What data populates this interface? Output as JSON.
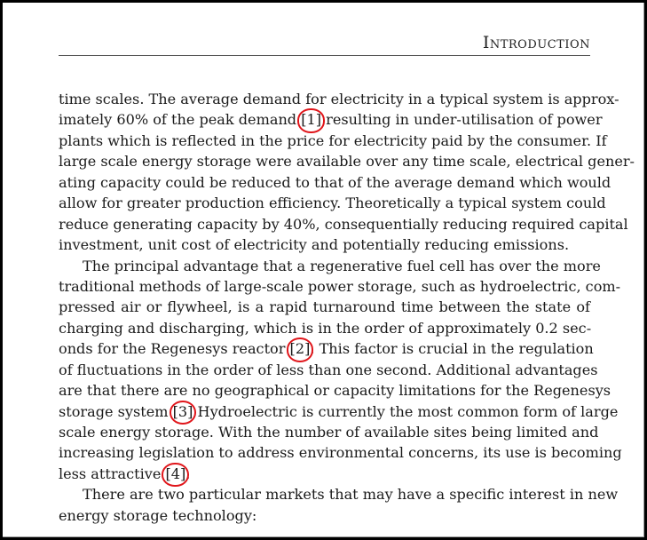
{
  "header": {
    "running_title": "Introduction"
  },
  "annotation_color": "#e0161b",
  "paragraphs": [
    {
      "lines": [
        [
          "time scales. The average demand for electricity in a typical system is approx-"
        ],
        [
          "imately 60% of the peak demand ",
          "[1]",
          " resulting in under-utilisation of power"
        ],
        [
          "plants which is reflected in the price for electricity paid by the consumer. If"
        ],
        [
          "large scale energy storage were available over any time scale, electrical gener-"
        ],
        [
          "ating capacity could be reduced to that of the average demand which would"
        ],
        [
          "allow for greater production efficiency. Theoretically a typical system could"
        ],
        [
          "reduce generating capacity by 40%, consequentially reducing required capital"
        ],
        [
          "investment, unit cost of electricity and potentially reducing emissions."
        ]
      ]
    },
    {
      "lines": [
        [
          "The principal advantage that a regenerative fuel cell has over the more"
        ],
        [
          "traditional methods of large-scale power storage, such as hydroelectric, com-"
        ],
        [
          "pressed air or flywheel, is a rapid turnaround time between the state of"
        ],
        [
          "charging and discharging, which is in the order of approximately 0.2 sec-"
        ],
        [
          "onds for the Regenesys reactor ",
          "[2]",
          ". This factor is crucial in the regulation"
        ],
        [
          "of fluctuations in the order of less than one second. Additional advantages"
        ],
        [
          "are that there are no geographical or capacity limitations for the Regenesys"
        ],
        [
          "storage system ",
          "[3]",
          " Hydroelectric is currently the most common form of large"
        ],
        [
          "scale energy storage. With the number of available sites being limited and"
        ],
        [
          "increasing legislation to address environmental concerns, its use is becoming"
        ],
        [
          "less attractive ",
          "[4]",
          "."
        ]
      ]
    },
    {
      "lines": [
        [
          "There are two particular markets that may have a specific interest in new"
        ],
        [
          "energy storage technology:"
        ]
      ]
    }
  ],
  "citations": [
    "[1]",
    "[2]",
    "[3]",
    "[4]"
  ]
}
